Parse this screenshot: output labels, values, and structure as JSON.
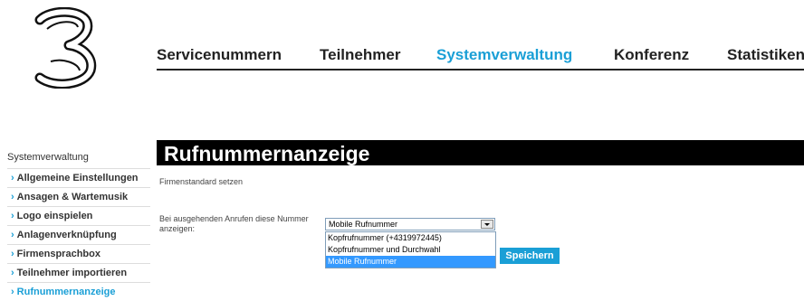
{
  "nav": {
    "items": [
      "Servicenummern",
      "Teilnehmer",
      "Systemverwaltung",
      "Konferenz",
      "Statistiken"
    ],
    "active": "Systemverwaltung"
  },
  "sidebar": {
    "title": "Systemverwaltung",
    "items": [
      "Allgemeine Einstellungen",
      "Ansagen & Wartemusik",
      "Logo einspielen",
      "Anlagenverknüpfung",
      "Firmensprachbox",
      "Teilnehmer importieren",
      "Rufnummernanzeige"
    ],
    "active": "Rufnummernanzeige"
  },
  "page": {
    "title": "Rufnummernanzeige",
    "subtitle": "Firmenstandard setzen",
    "label": "Bei ausgehenden Anrufen diese Nummer anzeigen:"
  },
  "select": {
    "value": "Mobile Rufnummer",
    "options": [
      "Kopfrufnummer (+4319972445)",
      "Kopfrufnummer und Durchwahl",
      "Mobile Rufnummer"
    ]
  },
  "save_label": "Speichern",
  "colors": {
    "accent": "#1a9fd6",
    "header_bar": "#000000"
  }
}
